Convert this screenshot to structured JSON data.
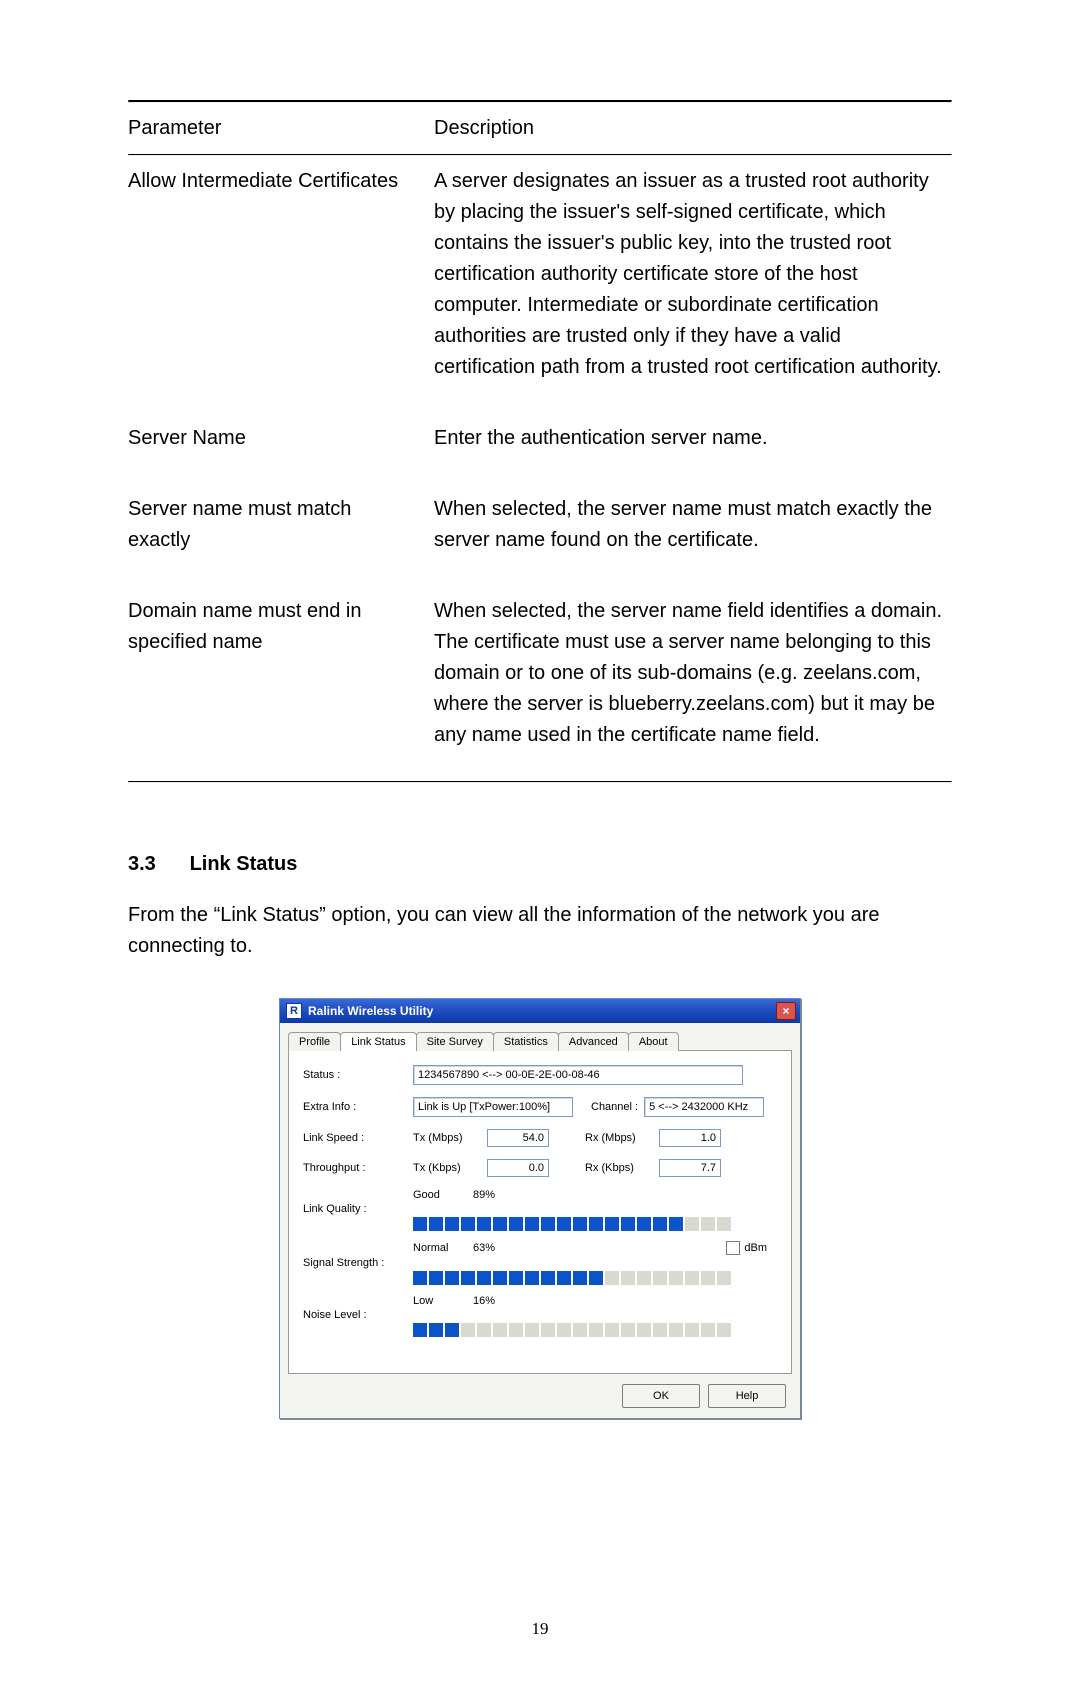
{
  "table": {
    "headers": {
      "p": "Parameter",
      "d": "Description"
    },
    "rows": [
      {
        "p": "Allow Intermediate Certificates",
        "d": "A server designates an issuer as a trusted root authority by placing the issuer's self-signed certificate, which contains the issuer's public key, into the trusted root certification authority certificate store of the host computer. Intermediate or subordinate certification authorities are trusted only if they have a valid certification path from a trusted root certification authority."
      },
      {
        "p": "Server Name",
        "d": "Enter the authentication server name."
      },
      {
        "p": "Server name must match exactly",
        "d": "When selected, the server name must match exactly the server name found on the certificate."
      },
      {
        "p": "Domain name must end in specified name",
        "d": "When selected, the server name field identifies a domain. The certificate must use a server name belonging to this domain or to one of its sub-domains (e.g. zeelans.com, where the server is blueberry.zeelans.com) but it may be any name used in the certificate name field."
      }
    ]
  },
  "section": {
    "num": "3.3",
    "title": "Link Status"
  },
  "paragraph": "From the “Link Status” option, you can view all the information of the network you are connecting to.",
  "dialog": {
    "title": "Ralink Wireless Utility",
    "icon": "R",
    "tabs": [
      "Profile",
      "Link Status",
      "Site Survey",
      "Statistics",
      "Advanced",
      "About"
    ],
    "active_tab": 1,
    "labels": {
      "status": "Status :",
      "extra": "Extra Info :",
      "channel": "Channel :",
      "linkspeed": "Link Speed :",
      "throughput": "Throughput :",
      "tx_mbps": "Tx (Mbps)",
      "rx_mbps": "Rx (Mbps)",
      "tx_kbps": "Tx (Kbps)",
      "rx_kbps": "Rx (Kbps)",
      "link_quality": "Link Quality :",
      "signal_strength": "Signal Strength :",
      "noise_level": "Noise Level :",
      "good": "Good",
      "normal": "Normal",
      "low": "Low",
      "dbm": "dBm",
      "ok": "OK",
      "help": "Help"
    },
    "values": {
      "status": "1234567890 <--> 00-0E-2E-00-08-46",
      "extra": "Link is Up [TxPower:100%]",
      "channel": "5 <--> 2432000 KHz",
      "tx_mbps": "54.0",
      "rx_mbps": "1.0",
      "tx_kbps": "0.0",
      "rx_kbps": "7.7",
      "link_quality_pct": "89%",
      "signal_strength_pct": "63%",
      "noise_level_pct": "16%"
    }
  },
  "chart_data": [
    {
      "type": "bar",
      "title": "Link Quality",
      "categories": [
        "segments"
      ],
      "values": [
        17
      ],
      "ylim": [
        0,
        20
      ],
      "percent": 89
    },
    {
      "type": "bar",
      "title": "Signal Strength",
      "categories": [
        "segments"
      ],
      "values": [
        12
      ],
      "ylim": [
        0,
        20
      ],
      "percent": 63
    },
    {
      "type": "bar",
      "title": "Noise Level",
      "categories": [
        "segments"
      ],
      "values": [
        3
      ],
      "ylim": [
        0,
        20
      ],
      "percent": 16
    }
  ],
  "page_number": "19"
}
